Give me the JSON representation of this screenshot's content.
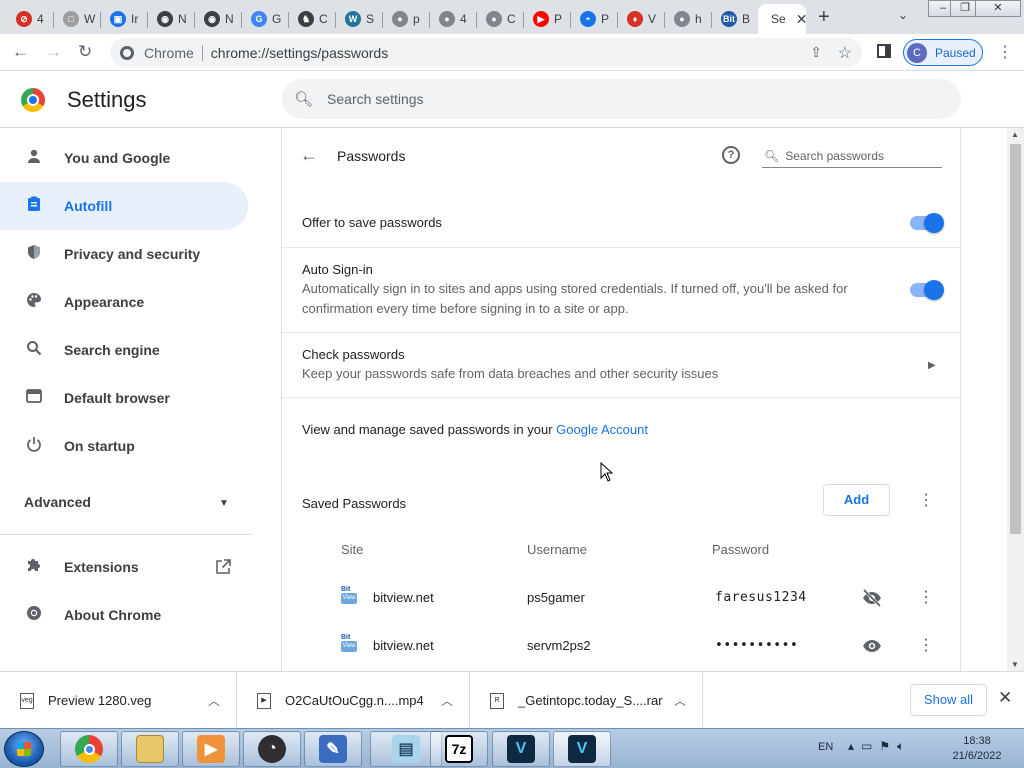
{
  "tabs": [
    {
      "title": "4",
      "icon_color": "#d93025",
      "icon_text": "⊘"
    },
    {
      "title": "W",
      "icon_color": "#9e9e9e",
      "icon_text": "□"
    },
    {
      "title": "Ir",
      "icon_color": "#1a73e8",
      "icon_text": "▣"
    },
    {
      "title": "N",
      "icon_color": "#3c4043",
      "icon_text": "◉"
    },
    {
      "title": "N",
      "icon_color": "#3c4043",
      "icon_text": "◉"
    },
    {
      "title": "G",
      "icon_color": "#4285f4",
      "icon_text": "G"
    },
    {
      "title": "C",
      "icon_color": "#3c4043",
      "icon_text": "♞"
    },
    {
      "title": "S",
      "icon_color": "#21759b",
      "icon_text": "W"
    },
    {
      "title": "p",
      "icon_color": "#80868b",
      "icon_text": "●"
    },
    {
      "title": "4",
      "icon_color": "#80868b",
      "icon_text": "●"
    },
    {
      "title": "C",
      "icon_color": "#80868b",
      "icon_text": "●"
    },
    {
      "title": "P",
      "icon_color": "#ff0000",
      "icon_text": "▶"
    },
    {
      "title": "P",
      "icon_color": "#1a73e8",
      "icon_text": "◓"
    },
    {
      "title": "V",
      "icon_color": "#d93025",
      "icon_text": "♦"
    },
    {
      "title": "h",
      "icon_color": "#80868b",
      "icon_text": "●"
    },
    {
      "title": "B",
      "icon_color": "#1e5aa8",
      "icon_text": "Bit"
    },
    {
      "title": "Se",
      "icon_color": "#fff",
      "icon_text": ""
    }
  ],
  "toolbar": {
    "scheme": "Chrome",
    "url": "chrome://settings/passwords",
    "profile_initial": "C",
    "profile_status": "Paused"
  },
  "header": {
    "title": "Settings",
    "search_placeholder": "Search settings"
  },
  "sidebar": {
    "items": [
      {
        "label": "You and Google",
        "icon": "person-icon"
      },
      {
        "label": "Autofill",
        "icon": "clipboard-icon"
      },
      {
        "label": "Privacy and security",
        "icon": "shield-icon"
      },
      {
        "label": "Appearance",
        "icon": "palette-icon"
      },
      {
        "label": "Search engine",
        "icon": "search-icon"
      },
      {
        "label": "Default browser",
        "icon": "browser-icon"
      },
      {
        "label": "On startup",
        "icon": "power-icon"
      }
    ],
    "advanced": "Advanced",
    "extensions": "Extensions",
    "about": "About Chrome"
  },
  "passwords": {
    "title": "Passwords",
    "search_placeholder": "Search passwords",
    "offer_save": "Offer to save passwords",
    "auto_signin_title": "Auto Sign-in",
    "auto_signin_desc": "Automatically sign in to sites and apps using stored credentials. If turned off, you'll be asked for confirmation every time before signing in to a site or app.",
    "check_title": "Check passwords",
    "check_desc": "Keep your passwords safe from data breaches and other security issues",
    "manage_text": "View and manage saved passwords in your ",
    "manage_link": "Google Account",
    "saved_title": "Saved Passwords",
    "add_label": "Add",
    "col_site": "Site",
    "col_username": "Username",
    "col_password": "Password",
    "entries": [
      {
        "site": "bitview.net",
        "username": "ps5gamer",
        "password": "faresus1234",
        "visible": true
      },
      {
        "site": "bitview.net",
        "username": "servm2ps2",
        "password": "••••••••••",
        "visible": false
      }
    ],
    "accent": "#1a73e8"
  },
  "downloads": {
    "items": [
      {
        "name": "Preview 1280.veg",
        "icon": "veg"
      },
      {
        "name": "O2CaUtOuCgg.n....mp4",
        "icon": "mp4"
      },
      {
        "name": "_Getintopc.today_S....rar",
        "icon": "rar"
      }
    ],
    "show_all": "Show all"
  },
  "taskbar": {
    "lang": "EN",
    "time": "18:38",
    "date": "21/6/2022"
  }
}
